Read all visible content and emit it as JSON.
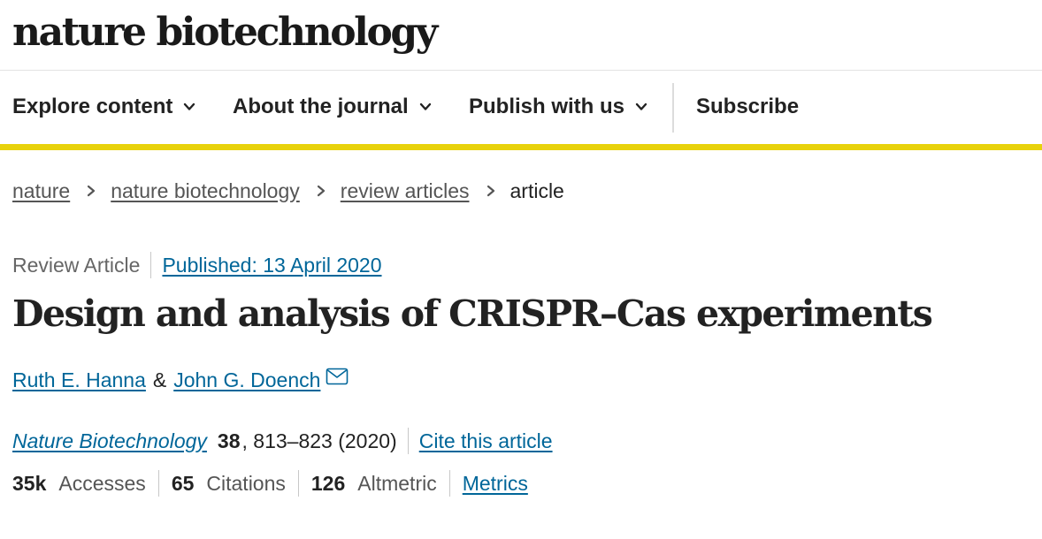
{
  "brand": {
    "logo_text": "nature biotechnology"
  },
  "nav": {
    "items": [
      {
        "label": "Explore content",
        "icon": "chevron-down-icon"
      },
      {
        "label": "About the journal",
        "icon": "chevron-down-icon"
      },
      {
        "label": "Publish with us",
        "icon": "chevron-down-icon"
      }
    ],
    "subscribe_label": "Subscribe",
    "accent_color": "#e8d20c"
  },
  "breadcrumb": {
    "items": [
      "nature",
      "nature biotechnology",
      "review articles"
    ],
    "current": "article",
    "separator_icon": "chevron-right-icon"
  },
  "article": {
    "type": "Review Article",
    "published": "Published: 13 April 2020",
    "title": "Design and analysis of CRISPR–Cas experiments",
    "authors": [
      {
        "name": "Ruth E. Hanna"
      },
      {
        "name": "John G. Doench",
        "contact_icon": "mail-icon"
      }
    ],
    "author_separator": "&",
    "citation": {
      "journal": "Nature Biotechnology",
      "volume": "38",
      "pages": ", 813–823 (2020)",
      "cite_label": "Cite this article"
    },
    "metrics": {
      "accesses_value": "35k",
      "accesses_label": "Accesses",
      "citations_value": "65",
      "citations_label": "Citations",
      "altmetric_value": "126",
      "altmetric_label": "Altmetric",
      "metrics_link": "Metrics"
    }
  },
  "colors": {
    "link": "#006699",
    "text": "#222222",
    "muted": "#555555"
  }
}
